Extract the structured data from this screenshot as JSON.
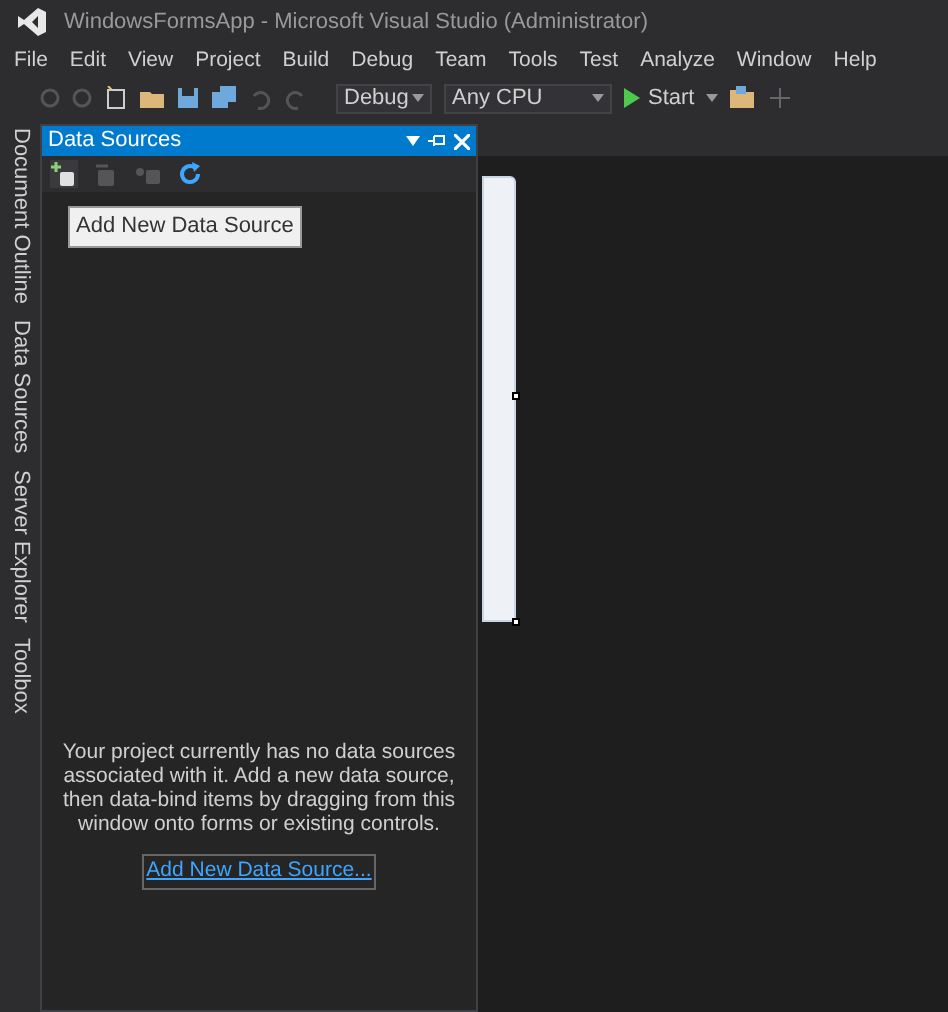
{
  "window": {
    "title": "WindowsFormsApp - Microsoft Visual Studio  (Administrator)"
  },
  "menu": [
    "File",
    "Edit",
    "View",
    "Project",
    "Build",
    "Debug",
    "Team",
    "Tools",
    "Test",
    "Analyze",
    "Window",
    "Help"
  ],
  "toolbar": {
    "configuration": "Debug",
    "platform": "Any CPU",
    "start": "Start"
  },
  "side_tabs": [
    {
      "label": "Document Outline"
    },
    {
      "label": "Data Sources"
    },
    {
      "label": "Server Explorer"
    },
    {
      "label": "Toolbox"
    }
  ],
  "panel": {
    "title": "Data Sources",
    "tools": [
      {
        "kind": "add",
        "disabled": false
      },
      {
        "kind": "edit",
        "disabled": true
      },
      {
        "kind": "configure",
        "disabled": true
      },
      {
        "kind": "refresh",
        "disabled": false
      }
    ],
    "tooltip": "Add New Data Source",
    "message": "Your project currently has no data sources associated with it. Add a new data source, then data-bind items by dragging from this window onto forms or existing controls.",
    "link": "Add New Data Source..."
  }
}
